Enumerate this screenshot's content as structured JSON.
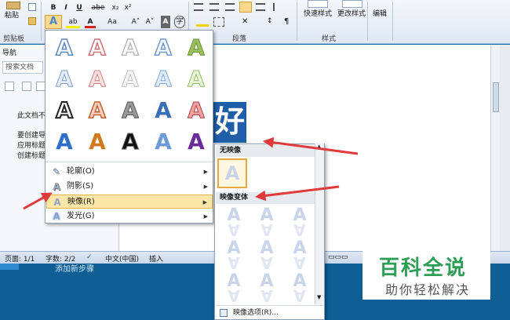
{
  "ribbon": {
    "paste_label": "粘贴",
    "clipboard_label": "剪贴板",
    "paragraph_label": "段落",
    "styles_label": "样式",
    "quick_styles_label": "快速样式",
    "change_styles_label": "更改样式",
    "edit_label": "编辑",
    "bold": "B",
    "italic": "I",
    "underline": "U",
    "strike": "abe",
    "subscript": "x₂",
    "superscript": "x²",
    "font_size_up": "A˄",
    "font_size_down": "A˅"
  },
  "nav": {
    "title": "导航",
    "search_placeholder": "搜索文档",
    "lines": [
      "此文档不",
      "要创建导",
      "应用标题",
      "创建标题"
    ]
  },
  "text_effects_menu": {
    "items": [
      {
        "label": "轮廓(O)",
        "icon": "outline-icon"
      },
      {
        "label": "阴影(S)",
        "icon": "shadow-icon"
      },
      {
        "label": "映像(R)",
        "icon": "reflection-icon"
      },
      {
        "label": "发光(G)",
        "icon": "glow-icon"
      }
    ]
  },
  "reflection_submenu": {
    "no_reflection_header": "无映像",
    "variants_header": "映像变体",
    "options_label": "映像选项(R)..."
  },
  "doc": {
    "glyph": "好"
  },
  "statusbar": {
    "page": "页面: 1/1",
    "words": "字数: 2/2",
    "language": "中文(中国)",
    "insert": "插入"
  },
  "taskbar": {
    "text": "添加新步骤"
  },
  "watermark": {
    "big": "百科全说",
    "small": "助你轻松解决"
  },
  "colors": {
    "highlight": "#fde7a8",
    "arrow": "#e03a3a",
    "brand_green": "#2e9e57"
  }
}
